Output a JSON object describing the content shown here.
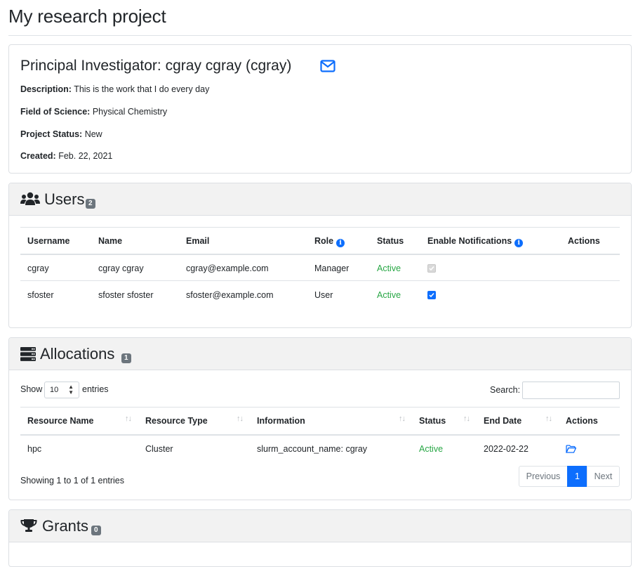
{
  "page": {
    "title": "My research project"
  },
  "pi": {
    "title": "Principal Investigator: cgray cgray (cgray)",
    "description_label": "Description:",
    "description": "This is the work that I do every day",
    "field_label": "Field of Science:",
    "field": "Physical Chemistry",
    "status_label": "Project Status:",
    "status": "New",
    "created_label": "Created:",
    "created": "Feb. 22, 2021"
  },
  "users": {
    "title": "Users",
    "count": "2",
    "columns": [
      "Username",
      "Name",
      "Email",
      "Role",
      "Status",
      "Enable Notifications",
      "Actions"
    ],
    "rows": [
      {
        "username": "cgray",
        "name": "cgray cgray",
        "email": "cgray@example.com",
        "role": "Manager",
        "status": "Active",
        "notifications": true,
        "notifications_disabled": true
      },
      {
        "username": "sfoster",
        "name": "sfoster sfoster",
        "email": "sfoster@example.com",
        "role": "User",
        "status": "Active",
        "notifications": true,
        "notifications_disabled": false
      }
    ]
  },
  "allocations": {
    "title": "Allocations",
    "count": "1",
    "show_label": "Show",
    "entries_value": "10",
    "entries_label": "entries",
    "search_label": "Search:",
    "search_value": "",
    "columns": [
      "Resource Name",
      "Resource Type",
      "Information",
      "Status",
      "End Date",
      "Actions"
    ],
    "rows": [
      {
        "resource_name": "hpc",
        "resource_type": "Cluster",
        "information": "slurm_account_name: cgray",
        "status": "Active",
        "end_date": "2022-02-22"
      }
    ],
    "summary": "Showing 1 to 1 of 1 entries",
    "pagination": {
      "previous": "Previous",
      "current": "1",
      "next": "Next"
    }
  },
  "grants": {
    "title": "Grants",
    "count": "0"
  },
  "colors": {
    "accent": "#0d6efd",
    "active": "#28a745",
    "badge": "#6c757d",
    "header_bg": "#f2f2f2"
  }
}
